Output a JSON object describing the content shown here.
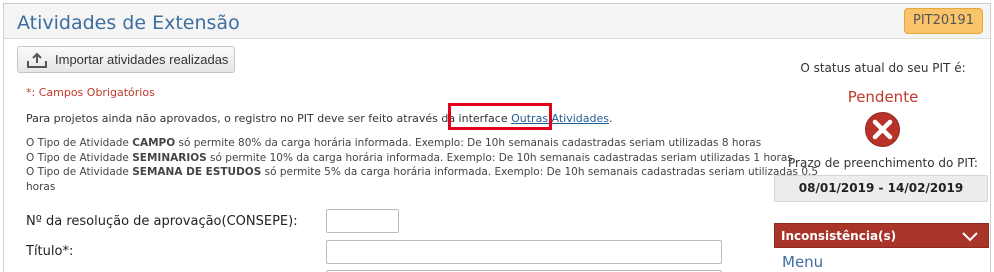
{
  "header": {
    "title": "Atividades de Extensão",
    "badge": "PIT20191"
  },
  "toolbar": {
    "import_label": "Importar atividades realizadas",
    "import_icon": "upload-icon"
  },
  "form": {
    "required_note": "*: Campos Obrigatórios",
    "info_prefix": "Para projetos ainda não aprovados, o registro no PIT deve ser feito através da interface ",
    "info_link": "Outras Atividades",
    "info_suffix": ".",
    "rules": [
      {
        "prefix": "O Tipo de Atividade ",
        "type": "CAMPO",
        "suffix": " só permite 80% da carga horária informada. Exemplo: De 10h semanais cadastradas seriam utilizadas 8 horas"
      },
      {
        "prefix": "O Tipo de Atividade ",
        "type": "SEMINARIOS",
        "suffix": " só permite 10% da carga horária informada. Exemplo: De 10h semanais cadastradas seriam utilizadas 1 horas"
      },
      {
        "prefix": "O Tipo de Atividade ",
        "type": "SEMANA DE ESTUDOS",
        "suffix": " só permite 5% da carga horária informada. Exemplo: De 10h semanais cadastradas seriam utilizadas 0,5"
      },
      {
        "prefix": "horas",
        "type": "",
        "suffix": ""
      }
    ],
    "resolucao_label": "Nº da resolução de aprovação(CONSEPE):",
    "resolucao_value": "",
    "titulo_label": "Título*:",
    "titulo_value": ""
  },
  "sidebar": {
    "status_label": "O status atual do seu PIT é:",
    "status_value": "Pendente",
    "status_icon": "error-x-icon",
    "status_color": "#c0392b",
    "prazo_label": "Prazo de preenchimento do PIT:",
    "prazo_value": "08/01/2019 - 14/02/2019",
    "inconsistencias_label": "Inconsistência(s)",
    "menu_label": "Menu"
  },
  "colors": {
    "title": "#3c6fa0",
    "badge_bg": "#f9c46a",
    "highlight_box": "#e3001b",
    "inconsistencias_bg": "#a8342a"
  }
}
